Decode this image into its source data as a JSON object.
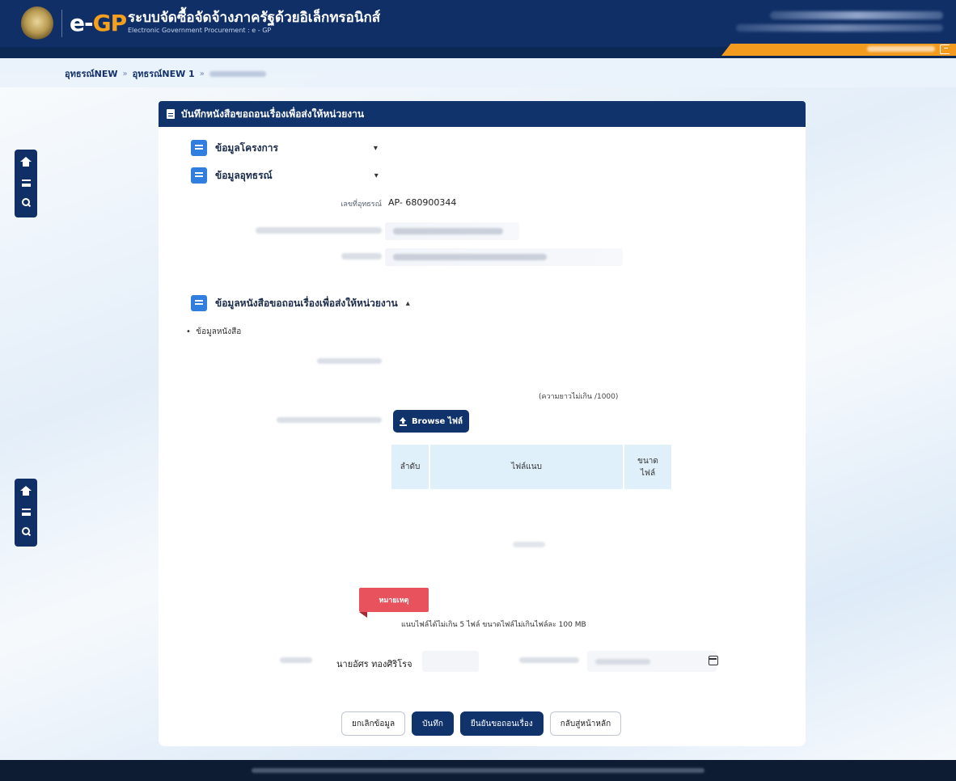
{
  "header": {
    "logo_prefix": "e-",
    "logo_suffix": "GP",
    "title_th": "ระบบจัดซื้อจัดจ้างภาครัฐด้วยอิเล็กทรอนิกส์",
    "title_en": "Electronic Government Procurement : e - GP",
    "user_name": "",
    "user_agency": "",
    "date_text": ""
  },
  "breadcrumb": {
    "items": [
      "อุทธรณ์NEW",
      "อุทธรณ์NEW 1",
      ""
    ]
  },
  "card": {
    "title": "บันทึกหนังสือขอถอนเรื่องเพื่อส่งให้หน่วยงาน",
    "sections": [
      {
        "label": "ข้อมูลโครงการ",
        "caret": "▾"
      },
      {
        "label": "ข้อมูลอุทธรณ์",
        "caret": "▾"
      },
      {
        "label": "ข้อมูลหนังสือขอถอนเรื่องเพื่อส่งให้หน่วยงาน",
        "caret": "▴"
      }
    ],
    "appeal_fields": {
      "appeal_no_label": "เลขที่อุทธรณ์",
      "appeal_no_value": "AP- 680900344",
      "id_label": "",
      "name_label": ""
    },
    "letter": {
      "bullet": "ข้อมูลหนังสือ",
      "detail_label": "",
      "counter": "(ความยาวไม่เกิน /1000)",
      "attach_label": "",
      "browse_label": "Browse ไฟล์"
    },
    "file_table": {
      "col_no": "ลำดับ",
      "col_file": "ไฟล์แนบ",
      "col_size": "ขนาดไฟล์",
      "empty_text": ""
    },
    "note": {
      "tag": "หมายเหตุ",
      "text": "แนบไฟล์ได้ไม่เกิน 5 ไฟล์ ขนาดไฟล์ไม่เกินไฟล์ละ 100 MB"
    },
    "withdraw": {
      "requester_label": "",
      "requester_value": "นายอัศร ทองศิริโรจ",
      "date_label": "",
      "date_value": ""
    },
    "actions": {
      "cancel": "ยกเลิกข้อมูล",
      "save": "บันทึก",
      "confirm": "ยืนยันขอถอนเรื่อง",
      "back": "กลับสู่หน้าหลัก"
    }
  },
  "footer": {
    "text": ""
  },
  "icons": [
    "seal-logo",
    "logout-icon",
    "home-icon",
    "menu-icon",
    "search-icon",
    "document-icon",
    "list-icon",
    "upload-icon",
    "calendar-icon"
  ],
  "colors": {
    "navy": "#11336c",
    "accent_orange": "#f39b1f",
    "section_blue": "#2f7ee0",
    "note_red": "#e8525c",
    "table_header": "#dff0fa"
  }
}
